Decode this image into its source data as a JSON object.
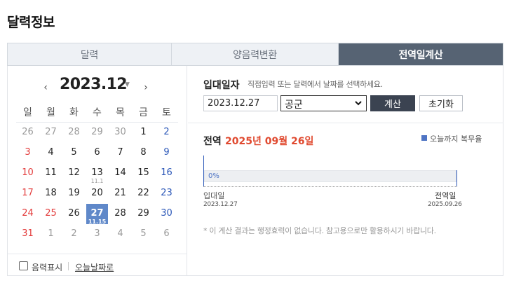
{
  "page_title": "달력정보",
  "tabs": [
    {
      "label": "달력",
      "active": false
    },
    {
      "label": "양음력변환",
      "active": false
    },
    {
      "label": "전역일계산",
      "active": true
    }
  ],
  "calendar": {
    "year_month": "2023.12",
    "weekdays": [
      "일",
      "월",
      "화",
      "수",
      "목",
      "금",
      "토"
    ],
    "weeks": [
      [
        {
          "d": "26",
          "t": "other"
        },
        {
          "d": "27",
          "t": "other"
        },
        {
          "d": "28",
          "t": "other"
        },
        {
          "d": "29",
          "t": "other"
        },
        {
          "d": "30",
          "t": "other"
        },
        {
          "d": "1",
          "t": ""
        },
        {
          "d": "2",
          "t": "sat"
        }
      ],
      [
        {
          "d": "3",
          "t": "sun"
        },
        {
          "d": "4",
          "t": ""
        },
        {
          "d": "5",
          "t": ""
        },
        {
          "d": "6",
          "t": ""
        },
        {
          "d": "7",
          "t": ""
        },
        {
          "d": "8",
          "t": ""
        },
        {
          "d": "9",
          "t": "sat"
        }
      ],
      [
        {
          "d": "10",
          "t": "sun"
        },
        {
          "d": "11",
          "t": ""
        },
        {
          "d": "12",
          "t": ""
        },
        {
          "d": "13",
          "t": "",
          "lunar": "11.1"
        },
        {
          "d": "14",
          "t": ""
        },
        {
          "d": "15",
          "t": ""
        },
        {
          "d": "16",
          "t": "sat"
        }
      ],
      [
        {
          "d": "17",
          "t": "sun"
        },
        {
          "d": "18",
          "t": ""
        },
        {
          "d": "19",
          "t": ""
        },
        {
          "d": "20",
          "t": ""
        },
        {
          "d": "21",
          "t": ""
        },
        {
          "d": "22",
          "t": ""
        },
        {
          "d": "23",
          "t": "sat"
        }
      ],
      [
        {
          "d": "24",
          "t": "sun"
        },
        {
          "d": "25",
          "t": "hol"
        },
        {
          "d": "26",
          "t": ""
        },
        {
          "d": "27",
          "t": "sel",
          "lunar": "11.15"
        },
        {
          "d": "28",
          "t": ""
        },
        {
          "d": "29",
          "t": ""
        },
        {
          "d": "30",
          "t": "sat"
        }
      ],
      [
        {
          "d": "31",
          "t": "sun"
        },
        {
          "d": "1",
          "t": "other"
        },
        {
          "d": "2",
          "t": "other"
        },
        {
          "d": "3",
          "t": "other"
        },
        {
          "d": "4",
          "t": "other"
        },
        {
          "d": "5",
          "t": "other"
        },
        {
          "d": "6",
          "t": "other"
        }
      ]
    ],
    "lunar_toggle_label": "음력표시",
    "today_link_label": "오늘날짜로"
  },
  "form": {
    "label": "입대일자",
    "help": "직접입력 또는 달력에서 날짜를 선택하세요.",
    "date_value": "2023.12.27",
    "branch_selected": "공군",
    "calc_label": "계산",
    "reset_label": "초기화"
  },
  "result": {
    "title": "전역",
    "value": "2025년 09월 26일",
    "legend_label": "오늘까지 복무율",
    "progress_percent": 0,
    "progress_text": "0%",
    "start_label": "입대일",
    "start_date": "2023.12.27",
    "end_label": "전역일",
    "end_date": "2025.09.26",
    "notice": "* 이 계산 결과는 행정효력이 없습니다. 참고용으로만 활용하시기 바랍니다."
  },
  "colors": {
    "accent": "#5f88c9",
    "active_tab": "#566373",
    "result_value": "#e0492f",
    "progress": "#4f74c4"
  }
}
